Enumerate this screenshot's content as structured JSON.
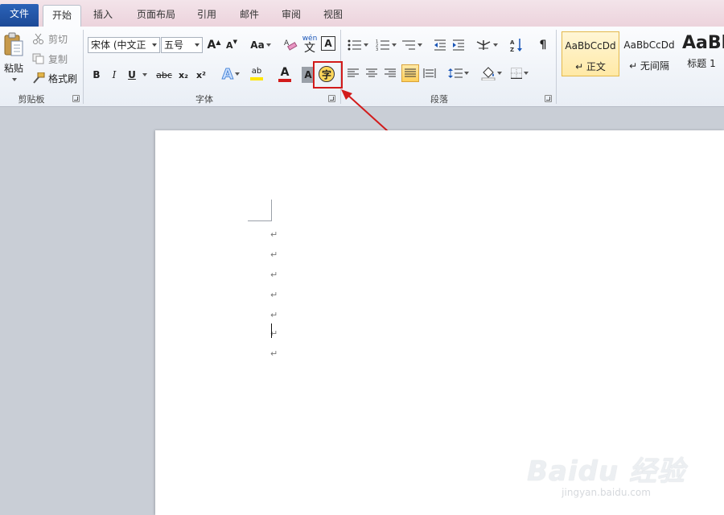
{
  "tabs": [
    {
      "label": "文件"
    },
    {
      "label": "开始"
    },
    {
      "label": "插入"
    },
    {
      "label": "页面布局"
    },
    {
      "label": "引用"
    },
    {
      "label": "邮件"
    },
    {
      "label": "审阅"
    },
    {
      "label": "视图"
    }
  ],
  "clipboard": {
    "paste": "粘贴",
    "cut": "剪切",
    "copy": "复制",
    "format_painter": "格式刷",
    "group_label": "剪贴板"
  },
  "font": {
    "font_name": "宋体 (中文正",
    "font_size": "五号",
    "grow": "A",
    "shrink": "A",
    "change_case": "Aa",
    "bold": "B",
    "italic": "I",
    "underline": "U",
    "strike": "abc",
    "subscript": "x₂",
    "superscript": "x²",
    "text_effect": "A",
    "highlight": "ab",
    "font_color": "A",
    "char_shading": "A",
    "enclose_char": "字",
    "pinyin_a": "wén",
    "pinyin_b": "文",
    "char_border": "A",
    "group_label": "字体"
  },
  "paragraph": {
    "group_label": "段落"
  },
  "styles": [
    {
      "sample": "AaBbCcDd",
      "name": "↵ 正文"
    },
    {
      "sample": "AaBbCcDd",
      "name": "↵ 无间隔"
    },
    {
      "sample": "AaBl",
      "name": "标题 1"
    }
  ],
  "document": {
    "paragraph_mark": "↵"
  },
  "watermark": {
    "brand": "Baidu 经验",
    "url": "jingyan.baidu.com"
  },
  "colors": {
    "accent_red": "#d21b1b",
    "file_tab": "#2b62b8",
    "font_color_bar": "#d21b1b",
    "highlight_bar": "#ffe600"
  }
}
